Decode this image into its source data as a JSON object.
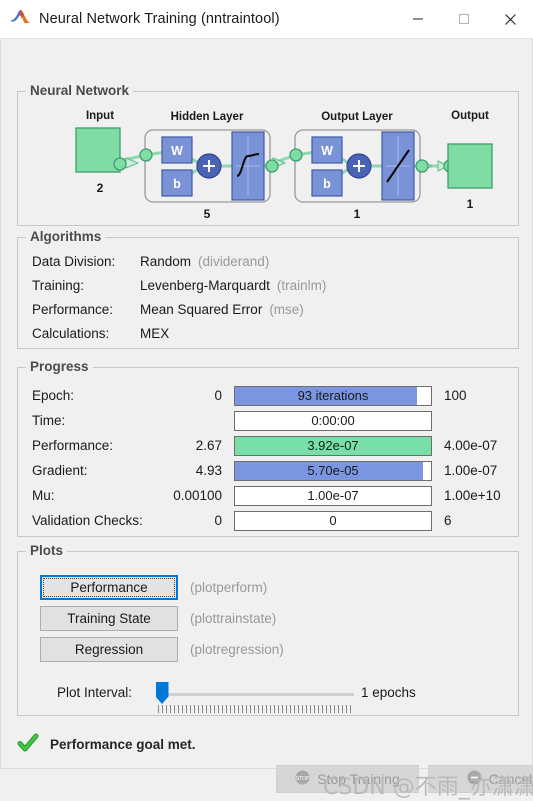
{
  "window": {
    "title": "Neural Network Training (nntraintool)",
    "logo_icon": "matlab-membrane-icon",
    "controls": {
      "minimize": "minimize-icon",
      "maximize": "maximize-icon",
      "close": "close-icon"
    }
  },
  "neural_network": {
    "group_title": "Neural Network",
    "input": {
      "label": "Input",
      "size": "2"
    },
    "hidden_layer": {
      "label": "Hidden Layer",
      "size": "5",
      "weight_label": "W",
      "bias_label": "b",
      "transfer": "sigmoid"
    },
    "output_layer": {
      "label": "Output Layer",
      "size": "1",
      "weight_label": "W",
      "bias_label": "b",
      "transfer": "linear"
    },
    "output": {
      "label": "Output",
      "size": "1"
    },
    "colors": {
      "node_green": "#7fdca5",
      "block_blue": "#7a92d6",
      "link_green": "#8fd9b0"
    }
  },
  "algorithms": {
    "group_title": "Algorithms",
    "rows": [
      {
        "label": "Data Division:",
        "value": "Random",
        "func": "(dividerand)"
      },
      {
        "label": "Training:",
        "value": "Levenberg-Marquardt",
        "func": "(trainlm)"
      },
      {
        "label": "Performance:",
        "value": "Mean Squared Error",
        "func": "(mse)"
      },
      {
        "label": "Calculations:",
        "value": "MEX",
        "func": ""
      }
    ]
  },
  "progress": {
    "group_title": "Progress",
    "rows": [
      {
        "label": "Epoch:",
        "current": "0",
        "bar_text": "93 iterations",
        "fill_percent": 93,
        "bar_color": "blue",
        "max": "100"
      },
      {
        "label": "Time:",
        "current": "",
        "bar_text": "0:00:00",
        "fill_percent": 0,
        "bar_color": "none",
        "max": ""
      },
      {
        "label": "Performance:",
        "current": "2.67",
        "bar_text": "3.92e-07",
        "fill_percent": 100,
        "bar_color": "green",
        "max": "4.00e-07"
      },
      {
        "label": "Gradient:",
        "current": "4.93",
        "bar_text": "5.70e-05",
        "fill_percent": 96,
        "bar_color": "blue",
        "max": "1.00e-07"
      },
      {
        "label": "Mu:",
        "current": "0.00100",
        "bar_text": "1.00e-07",
        "fill_percent": 0,
        "bar_color": "none",
        "max": "1.00e+10"
      },
      {
        "label": "Validation Checks:",
        "current": "0",
        "bar_text": "0",
        "fill_percent": 0,
        "bar_color": "none",
        "max": "6"
      }
    ],
    "colors": {
      "blue": "#7a96e0",
      "green": "#78dfa8"
    }
  },
  "plots": {
    "group_title": "Plots",
    "buttons": [
      {
        "label": "Performance",
        "func": "(plotperform)",
        "focused": true
      },
      {
        "label": "Training State",
        "func": "(plottrainstate)",
        "focused": false
      },
      {
        "label": "Regression",
        "func": "(plotregression)",
        "focused": false
      }
    ],
    "plot_interval": {
      "label": "Plot Interval:",
      "value_text": "1 epochs",
      "thumb_percent": 0
    }
  },
  "status": {
    "icon": "green-check-icon",
    "message": "Performance goal met."
  },
  "bottom_buttons": [
    {
      "label": "Stop Training",
      "icon": "stop-icon",
      "disabled": true
    },
    {
      "label": "Cancel",
      "icon": "cancel-icon",
      "disabled": true
    }
  ],
  "watermark": {
    "text": "CSDN @不雨_亦潇潇"
  }
}
